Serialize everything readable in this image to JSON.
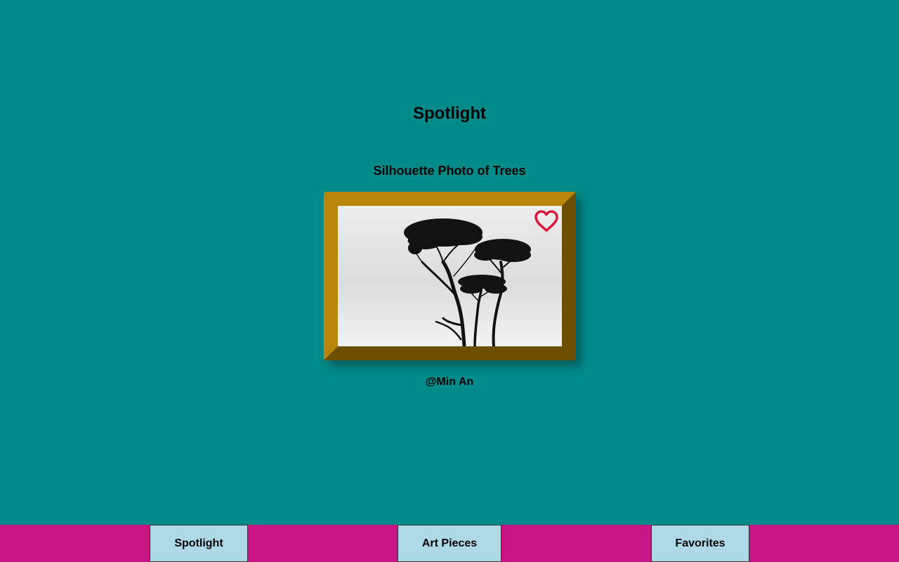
{
  "page": {
    "title": "Spotlight",
    "background_color": "#008b8b"
  },
  "artwork": {
    "title": "Silhouette Photo of Trees",
    "artist": "@Min An",
    "favorite": false,
    "favorite_icon": "heart-outline-icon",
    "favorite_color": "#dc143c",
    "frame_color": "#b8860b"
  },
  "nav": {
    "background_color": "#c71585",
    "button_color": "#add8e6",
    "items": [
      {
        "label": "Spotlight"
      },
      {
        "label": "Art Pieces"
      },
      {
        "label": "Favorites"
      }
    ]
  }
}
